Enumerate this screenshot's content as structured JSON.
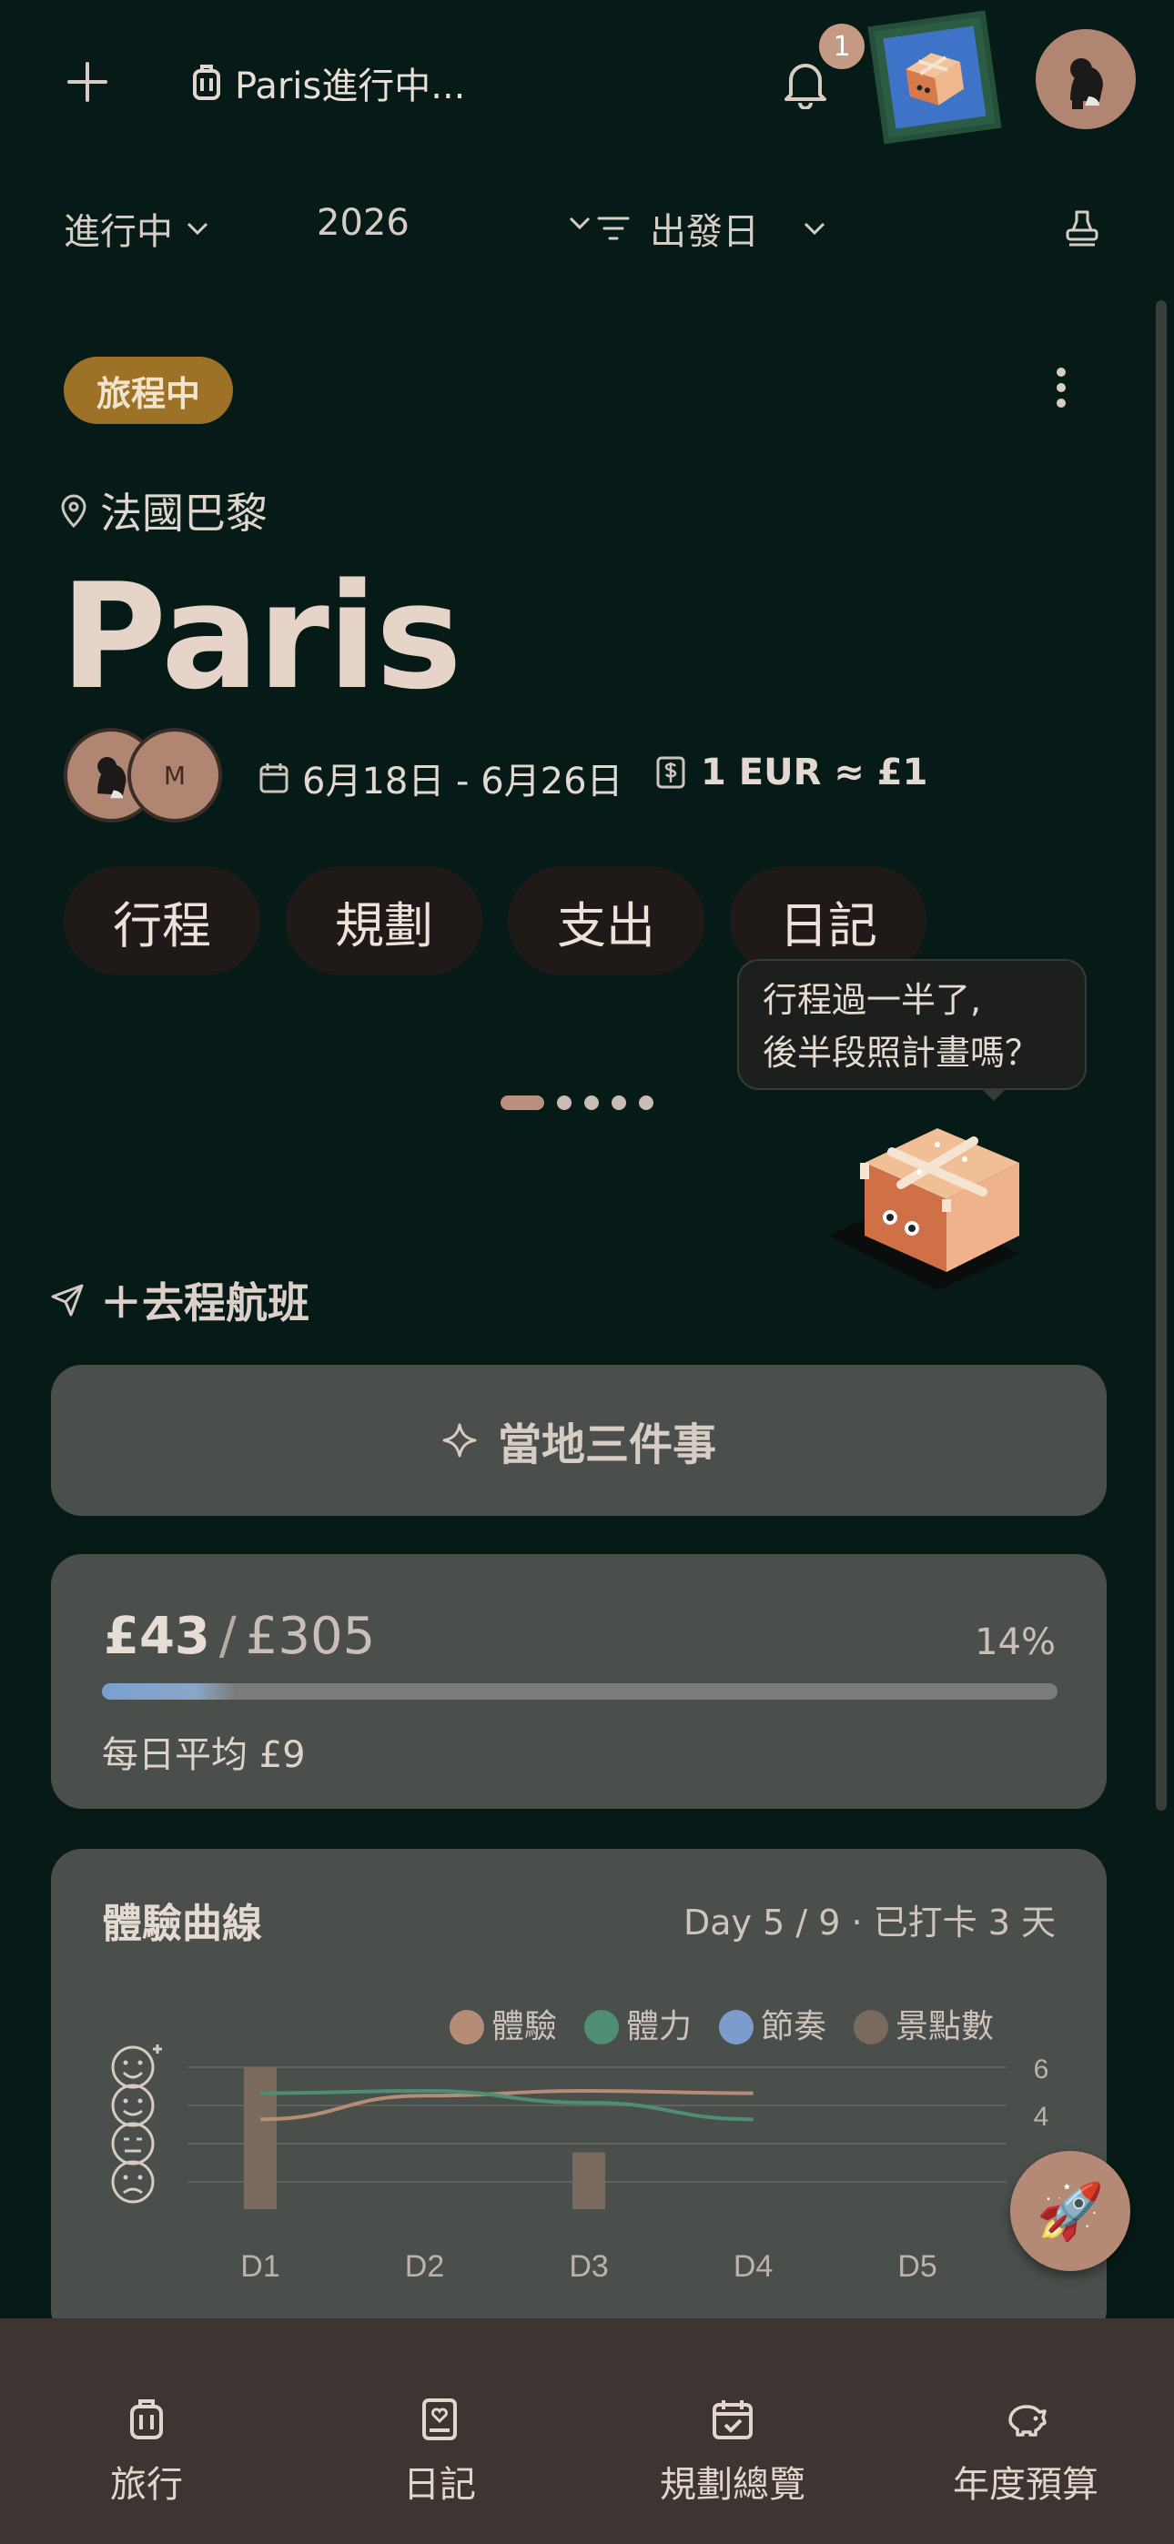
{
  "topbar": {
    "trip_name": "Paris進行中...",
    "notification_count": "1"
  },
  "filters": {
    "status": "進行中",
    "year": "2026",
    "sort": "出發日"
  },
  "trip": {
    "status_pill": "旅程中",
    "location": "法國巴黎",
    "title": "Paris",
    "member_initial": "M",
    "dates": "6月18日 - 6月26日",
    "exchange_rate": "1 EUR ≈ £1"
  },
  "tabs": [
    {
      "label": "行程"
    },
    {
      "label": "規劃"
    },
    {
      "label": "支出"
    },
    {
      "label": "日記"
    }
  ],
  "tooltip": {
    "line1": "行程過一半了,",
    "line2": "後半段照計畫嗎？"
  },
  "pager": {
    "count": 5,
    "active": 0
  },
  "flight": {
    "label": "＋去程航班"
  },
  "local": {
    "label": "當地三件事"
  },
  "budget": {
    "spent": "£43",
    "separator": "/",
    "total": "£305",
    "percent": "14%",
    "progress": 0.14,
    "daily": "每日平均 £9"
  },
  "experience_chart": {
    "title": "體驗曲線",
    "meta": "Day 5 / 9 · 已打卡 3 天",
    "legend": [
      {
        "name": "體驗",
        "color": "#b58c74"
      },
      {
        "name": "體力",
        "color": "#4f8e72"
      },
      {
        "name": "節奏",
        "color": "#7c9dcc"
      },
      {
        "name": "景點數",
        "color": "#7a6a5e"
      }
    ]
  },
  "chart_data": {
    "type": "line",
    "title": "體驗曲線",
    "categories": [
      "D1",
      "D2",
      "D3",
      "D4",
      "D5"
    ],
    "right_axis_ticks": [
      "6",
      "4"
    ],
    "series": [
      {
        "name": "體驗",
        "type": "line",
        "color": "#b58c74",
        "values": [
          3.8,
          4.8,
          5.0,
          4.9,
          null
        ]
      },
      {
        "name": "體力",
        "type": "line",
        "color": "#4f8e72",
        "values": [
          4.9,
          5.0,
          4.5,
          3.8,
          null
        ]
      },
      {
        "name": "景點數",
        "type": "bar",
        "color": "#7a6a5e",
        "values": [
          6,
          0,
          2.4,
          0,
          0
        ]
      }
    ],
    "y2lim": [
      0,
      6
    ]
  },
  "nav": [
    {
      "label": "旅行"
    },
    {
      "label": "日記"
    },
    {
      "label": "規劃總覽"
    },
    {
      "label": "年度預算"
    }
  ]
}
